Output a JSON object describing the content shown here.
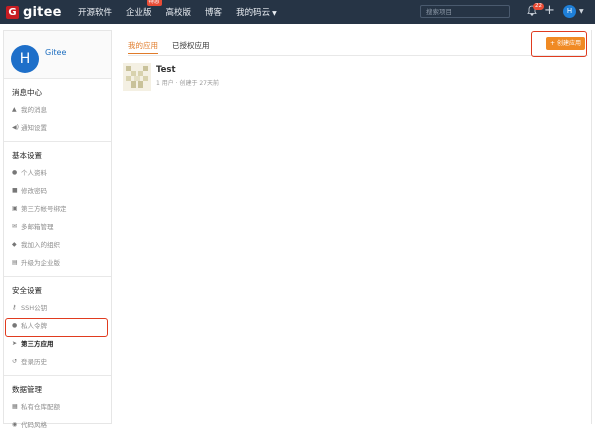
{
  "brand": {
    "logo_letter": "G",
    "name": "gitee"
  },
  "nav": {
    "items": [
      {
        "label": "开源软件"
      },
      {
        "label": "企业版",
        "badge": "特惠"
      },
      {
        "label": "高校版"
      },
      {
        "label": "博客"
      },
      {
        "label": "我的码云"
      }
    ],
    "search_placeholder": "搜索项目",
    "notification_count": "22",
    "user_initial": "H"
  },
  "profile": {
    "initial": "H",
    "name": "Gitee"
  },
  "sidebar": {
    "sections": [
      {
        "title": "消息中心",
        "items": [
          {
            "label": "我的消息",
            "icon": "bell-icon"
          },
          {
            "label": "通知设置",
            "icon": "volume-icon"
          }
        ]
      },
      {
        "title": "基本设置",
        "items": [
          {
            "label": "个人资料",
            "icon": "user-icon"
          },
          {
            "label": "修改密码",
            "icon": "lock-icon"
          },
          {
            "label": "第三方帐号绑定",
            "icon": "card-icon"
          },
          {
            "label": "多邮箱管理",
            "icon": "mail-icon"
          },
          {
            "label": "我加入的组织",
            "icon": "team-icon"
          },
          {
            "label": "升级为企业版",
            "icon": "upgrade-icon"
          }
        ]
      },
      {
        "title": "安全设置",
        "items": [
          {
            "label": "SSH公钥",
            "icon": "key-icon"
          },
          {
            "label": "私人令牌",
            "icon": "token-icon"
          },
          {
            "label": "第三方应用",
            "icon": "rocket-icon",
            "active": true
          },
          {
            "label": "登录历史",
            "icon": "history-icon"
          }
        ]
      },
      {
        "title": "数据管理",
        "items": [
          {
            "label": "私有仓库配额",
            "icon": "database-icon"
          },
          {
            "label": "代码风格",
            "icon": "palette-icon"
          }
        ]
      }
    ]
  },
  "main": {
    "tabs": [
      {
        "label": "我的应用",
        "active": true
      },
      {
        "label": "已授权应用",
        "active": false
      }
    ],
    "create_button": "+ 创建应用",
    "apps": [
      {
        "name": "Test",
        "meta": "1 用户 · 创建于 27天前"
      }
    ]
  },
  "colors": {
    "accent": "#f08a24",
    "nav_bg": "#263445",
    "highlight": "#e03b1f"
  }
}
